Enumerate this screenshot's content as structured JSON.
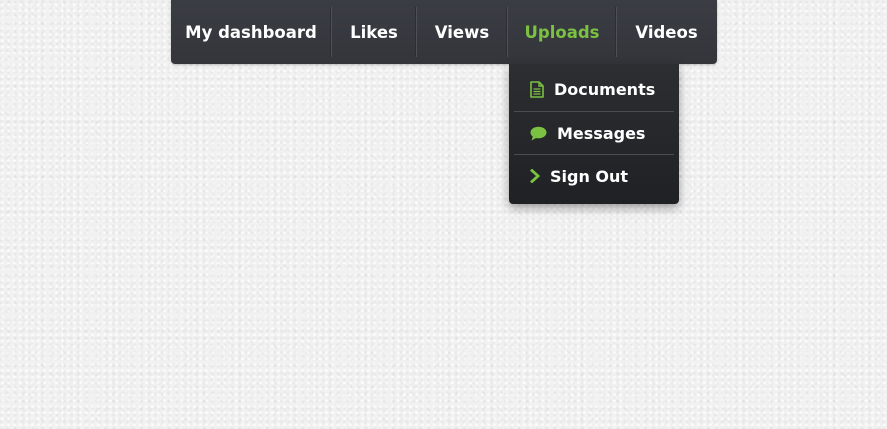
{
  "nav": {
    "items": [
      {
        "label": "My dashboard"
      },
      {
        "label": "Likes"
      },
      {
        "label": "Views"
      },
      {
        "label": "Uploads",
        "active": true
      },
      {
        "label": "Videos"
      }
    ]
  },
  "dropdown": {
    "items": [
      {
        "label": "Documents",
        "icon": "document-icon"
      },
      {
        "label": "Messages",
        "icon": "chat-bubble-icon"
      },
      {
        "label": "Sign Out",
        "icon": "chevron-right-icon"
      }
    ]
  },
  "colors": {
    "accent": "#7bc142",
    "nav_bg": "#35373d",
    "dropdown_bg": "#25272a",
    "text": "#ffffff"
  }
}
